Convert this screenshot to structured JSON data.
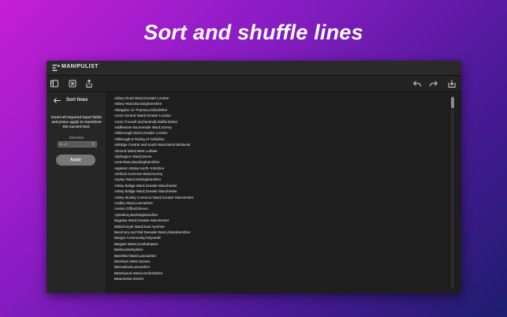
{
  "headline": "Sort and shuffle lines",
  "app": {
    "title": "MANIPULIST"
  },
  "toolbar": {
    "left_icons": [
      "sidebar-icon",
      "clear-icon",
      "share-icon"
    ],
    "right_icons": [
      "undo-icon",
      "redo-icon",
      "export-icon"
    ]
  },
  "sidebar": {
    "title": "Sort lines",
    "description": "Insert all required input fields and press apply to transform the current text.",
    "direction_label": "Direction",
    "direction_value": "A→Z",
    "apply_label": "Apply"
  },
  "lines": [
    "Abbey Road Ward,Greater London",
    "Abbey Ward,Buckinghamshire",
    "Abingdon on Thames,Oxfordshire",
    "Acton Central Ward,Greater London",
    "Acton Trussell and Bednall,Staffordshire",
    "Addlestone Bourneside Ward,Surrey",
    "Aldborough Ward,Greater London",
    "Aldbrough,E Riding of Yorkshire",
    "Aldridge Central and South Ward,West Midlands",
    "Almond Ward,West Lothian",
    "Alphington Ward,Devon",
    "Amersham,Buckinghamshire",
    "Appleton Wiske,North Yorkshire",
    "Ashford Common Ward,Surrey",
    "Aspley Ward,Nottinghamshire",
    "Astley Bridge Ward,Greater Manchester",
    "Astley Bridge Ward,Greater Manchester",
    "Astley Mosley Common Ward,Greater Manchester",
    "Audley Ward,Lancashire",
    "Aveton Gifford,Devon",
    "Aylesbury,Buckinghamshire",
    "Baguley Ward,Greater Manchester",
    "Ballochmyle Ward,East Ayrshire",
    "Banchory and Mid Deeside Ward,Aberdeenshire",
    "Bangor Community,Gwynedd",
    "Bargate Ward,Southampton",
    "Barlow,Derbyshire",
    "Barnfield Ward,Lancashire",
    "Barnham,West Sussex",
    "Barrowford,Lancashire",
    "Batchwood Ward,Hertfordshire",
    "Beaminster,Dorset"
  ]
}
